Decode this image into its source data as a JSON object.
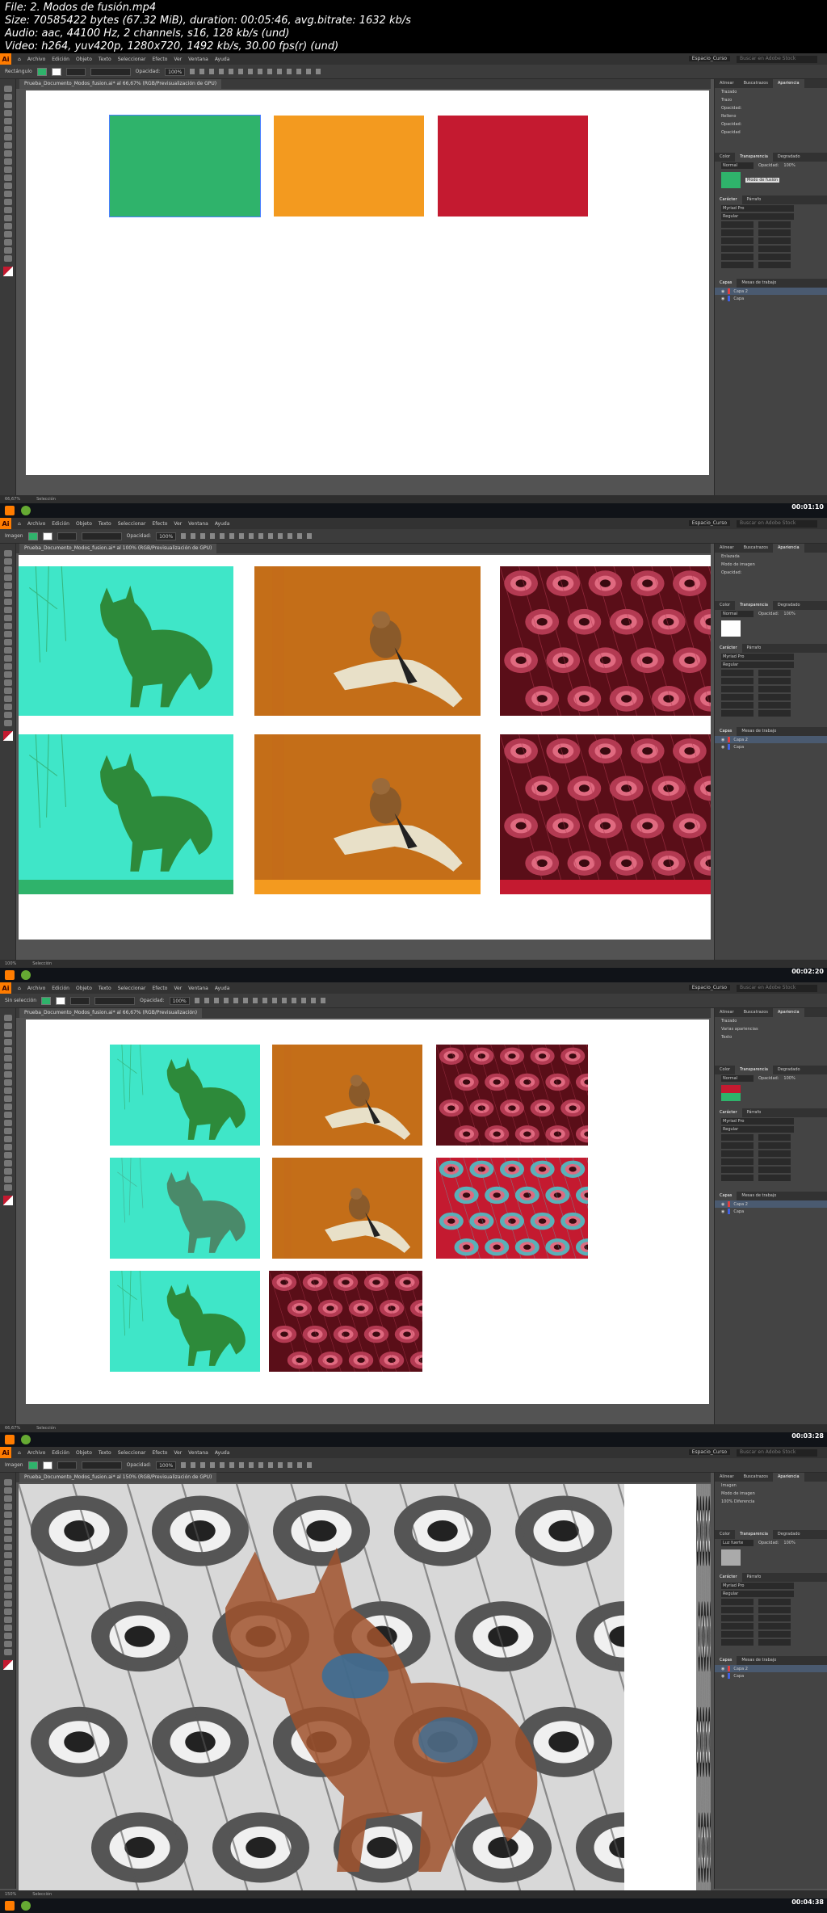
{
  "file_info": {
    "line1": "File: 2. Modos de fusión.mp4",
    "line2": "Size: 70585422 bytes (67.32 MiB), duration: 00:05:46, avg.bitrate: 1632 kb/s",
    "line3": "Audio: aac, 44100 Hz, 2 channels, s16, 128 kb/s (und)",
    "line4": "Video: h264, yuv420p, 1280x720, 1492 kb/s, 30.00 fps(r) (und)"
  },
  "menu": {
    "app_logo": "Ai",
    "items": [
      "Archivo",
      "Edición",
      "Objeto",
      "Texto",
      "Seleccionar",
      "Efecto",
      "Ver",
      "Ventana",
      "Ayuda"
    ],
    "workspace": "Espacio_Curso",
    "search_placeholder": "Buscar en Adobe Stock"
  },
  "frames": [
    {
      "ctrl_label": "Rectángulo",
      "opacity_label": "Opacidad:",
      "opacity_value": "100%",
      "doc_tab": "Prueba_Documento_Modos_fusion.ai* al 66,67% (RGB/Previsualización de GPU)",
      "panel_tabs": [
        "Alinear",
        "Buscatrazos",
        "Apariencia"
      ],
      "panel_rows": [
        "Trazado",
        "Trazo",
        "Opacidad:",
        "Relleno",
        "Opacidad:",
        "Opacidad"
      ],
      "transparency_tabs": [
        "Color",
        "Transparencia",
        "Degradado"
      ],
      "blend_mode": "Normal",
      "blend_tooltip": "Modo de fusión",
      "char_tabs": [
        "Carácter",
        "Párrafo"
      ],
      "font": "Myriad Pro",
      "style": "Regular",
      "layers_tabs": [
        "Capas",
        "Mesas de trabajo"
      ],
      "layers": [
        "Capa 2",
        "Capa"
      ],
      "status": [
        "66,67%",
        "Selección"
      ],
      "timestamp": "00:01:10"
    },
    {
      "ctrl_label": "Imagen",
      "opacity_label": "Opacidad:",
      "opacity_value": "100%",
      "doc_tab": "Prueba_Documento_Modos_fusion.ai* al 100% (RGB/Previsualización de GPU)",
      "panel_tabs": [
        "Alinear",
        "Buscatrazos",
        "Apariencia"
      ],
      "panel_rows": [
        "Enlazada",
        "Modo de imagen",
        "Opacidad:"
      ],
      "transparency_tabs": [
        "Color",
        "Transparencia",
        "Degradado"
      ],
      "blend_mode": "Normal",
      "blend_tooltip": "",
      "char_tabs": [
        "Carácter",
        "Párrafo"
      ],
      "font": "Myriad Pro",
      "style": "Regular",
      "layers_tabs": [
        "Capas",
        "Mesas de trabajo"
      ],
      "layers": [
        "Capa 2",
        "Capa"
      ],
      "status": [
        "100%",
        "Selección"
      ],
      "timestamp": "00:02:20"
    },
    {
      "ctrl_label": "Sin selección",
      "opacity_label": "Opacidad:",
      "opacity_value": "100%",
      "doc_tab": "Prueba_Documento_Modos_fusion.ai* al 66,67% (RGB/Previsualización)",
      "panel_tabs": [
        "Alinear",
        "Buscatrazos",
        "Apariencia"
      ],
      "panel_rows": [
        "Trazado",
        "Varias apariencias",
        "Texto"
      ],
      "transparency_tabs": [
        "Color",
        "Transparencia",
        "Degradado"
      ],
      "blend_mode": "Normal",
      "blend_tooltip": "",
      "char_tabs": [
        "Carácter",
        "Párrafo"
      ],
      "font": "Myriad Pro",
      "style": "Regular",
      "layers_tabs": [
        "Capas",
        "Mesas de trabajo"
      ],
      "layers": [
        "Capa 2",
        "Capa"
      ],
      "status": [
        "66,67%",
        "Selección"
      ],
      "timestamp": "00:03:28"
    },
    {
      "ctrl_label": "Imagen",
      "opacity_label": "Opacidad:",
      "opacity_value": "100%",
      "doc_tab": "Prueba_Documento_Modos_fusion.ai* al 150% (RGB/Previsualización de GPU)",
      "panel_tabs": [
        "Alinear",
        "Buscatrazos",
        "Apariencia"
      ],
      "panel_rows": [
        "Imagen",
        "Modo de imagen",
        "100% Diferencia"
      ],
      "transparency_tabs": [
        "Color",
        "Transparencia",
        "Degradado"
      ],
      "blend_mode": "Luz fuerte",
      "blend_tooltip": "",
      "char_tabs": [
        "Carácter",
        "Párrafo"
      ],
      "font": "Myriad Pro",
      "style": "Regular",
      "layers_tabs": [
        "Capas",
        "Mesas de trabajo"
      ],
      "layers": [
        "Capa 2",
        "Capa"
      ],
      "status": [
        "150%",
        "Selección"
      ],
      "timestamp": "00:04:38"
    }
  ],
  "colors": {
    "green": "#2fb36b",
    "orange": "#f39a1f",
    "red": "#c41a30",
    "cyan": "#3fe6c8"
  }
}
